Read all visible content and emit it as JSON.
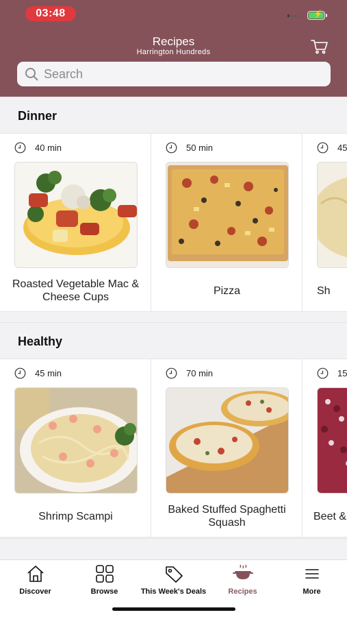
{
  "status": {
    "time": "03:48"
  },
  "header": {
    "title": "Recipes",
    "subtitle": "Harrington Hundreds",
    "cart_icon": "cart-icon",
    "accent": "#85525a"
  },
  "search": {
    "placeholder": "Search"
  },
  "sections": [
    {
      "title": "Dinner",
      "cards": [
        {
          "time": "40 min",
          "name": "Roasted Vegetable Mac & Cheese Cups"
        },
        {
          "time": "50 min",
          "name": "Pizza"
        },
        {
          "time": "45",
          "name": "Sh"
        }
      ]
    },
    {
      "title": "Healthy",
      "cards": [
        {
          "time": "45 min",
          "name": "Shrimp Scampi"
        },
        {
          "time": "70 min",
          "name": "Baked Stuffed Spaghetti Squash"
        },
        {
          "time": "15",
          "name": "Beet &"
        }
      ]
    }
  ],
  "tabs": [
    {
      "label": "Discover",
      "icon": "house-icon"
    },
    {
      "label": "Browse",
      "icon": "grid-icon"
    },
    {
      "label": "This Week's Deals",
      "icon": "tag-icon"
    },
    {
      "label": "Recipes",
      "icon": "cooking-pot-icon",
      "active": true
    },
    {
      "label": "More",
      "icon": "menu-icon"
    }
  ]
}
